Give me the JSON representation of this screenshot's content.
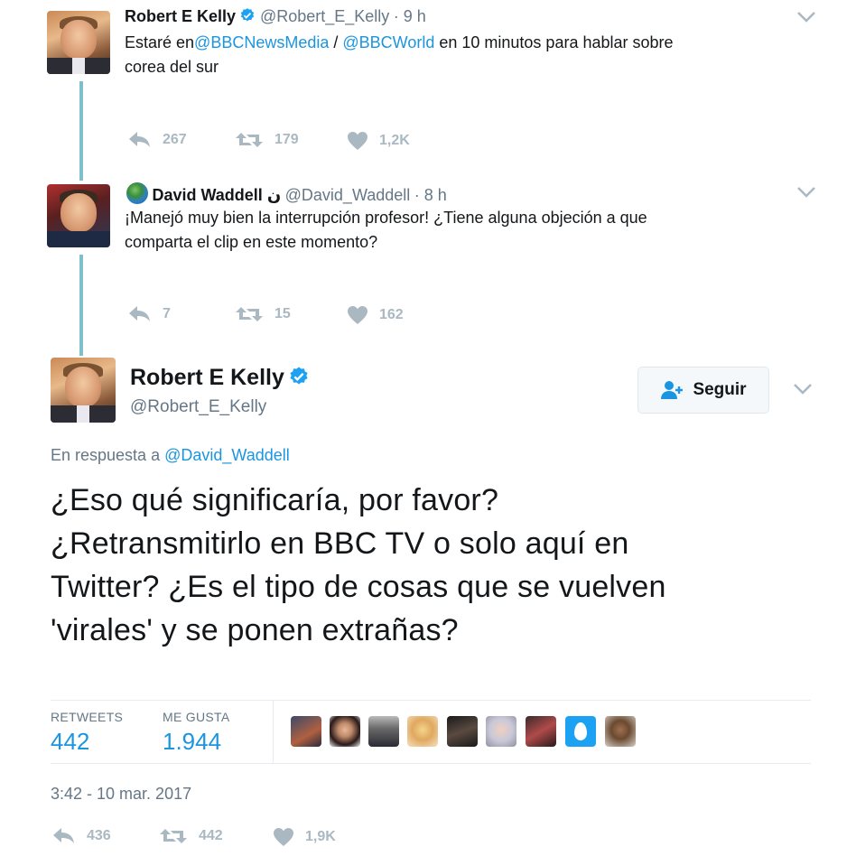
{
  "tweet1": {
    "name": "Robert E Kelly",
    "handle": "@Robert_E_Kelly",
    "time": "· 9 h",
    "text_prefix": "Estaré en",
    "mention1": "@BBCNewsMedia",
    "sep": " / ",
    "mention2": "@BBCWorld",
    "text_suffix": " en 10 minutos para hablar sobre",
    "text_line2": "corea del sur",
    "replies": "267",
    "retweets": "179",
    "likes": "1,2K"
  },
  "tweet2": {
    "name": "David Waddell ن",
    "handle": "@David_Waddell",
    "time": "· 8 h",
    "text_line1": "¡Manejó muy bien la interrupción profesor! ¿Tiene alguna objeción a que",
    "text_line2": "comparta el clip en este momento?",
    "replies": "7",
    "retweets": "15",
    "likes": "162"
  },
  "main": {
    "name": "Robert E Kelly",
    "handle": "@Robert_E_Kelly",
    "follow_label": "Seguir",
    "reply_prefix": "En respuesta a ",
    "reply_to": "@David_Waddell",
    "text_line1": "¿Eso qué significaría, por favor?",
    "text_line2": "¿Retransmitirlo en BBC TV o solo aquí en",
    "text_line3": "Twitter? ¿Es el tipo de cosas que se vuelven",
    "text_line4": "'virales' y se ponen extrañas?",
    "retweets_label": "RETWEETS",
    "retweets_value": "442",
    "likes_label": "ME GUSTA",
    "likes_value": "1.944",
    "timestamp": "3:42 - 10 mar. 2017",
    "replies": "436",
    "retweets": "442",
    "likes": "1,9K"
  },
  "colors": {
    "link": "#1b95e0",
    "muted": "#657786",
    "action": "#aab8c2",
    "thread_line": "#7fbfcc"
  }
}
